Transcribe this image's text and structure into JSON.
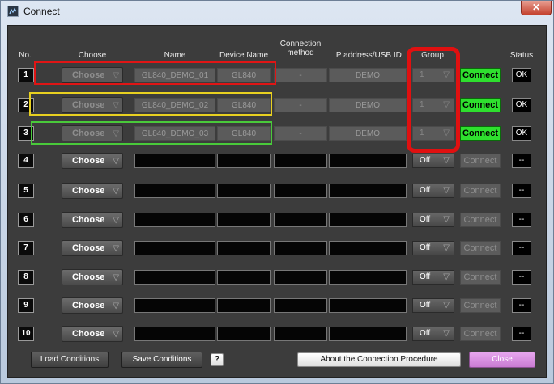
{
  "window": {
    "title": "Connect",
    "close_glyph": "✕"
  },
  "columns": {
    "no": "No.",
    "choose": "Choose",
    "name": "Name",
    "device_name": "Device Name",
    "connection_method": "Connection method",
    "ip_usb": "IP address/USB ID",
    "group": "Group",
    "status": "Status"
  },
  "rows": [
    {
      "no": "1",
      "choose": "Choose",
      "name": "GL840_DEMO_01",
      "device": "GL840",
      "method": "-",
      "ip": "DEMO",
      "group": "1",
      "connect": "Connect",
      "status": "OK",
      "active": true
    },
    {
      "no": "2",
      "choose": "Choose",
      "name": "GL840_DEMO_02",
      "device": "GL840",
      "method": "-",
      "ip": "DEMO",
      "group": "1",
      "connect": "Connect",
      "status": "OK",
      "active": true
    },
    {
      "no": "3",
      "choose": "Choose",
      "name": "GL840_DEMO_03",
      "device": "GL840",
      "method": "-",
      "ip": "DEMO",
      "group": "1",
      "connect": "Connect",
      "status": "OK",
      "active": true
    },
    {
      "no": "4",
      "choose": "Choose",
      "name": "",
      "device": "",
      "method": "",
      "ip": "",
      "group": "Off",
      "connect": "Connect",
      "status": "--",
      "active": false
    },
    {
      "no": "5",
      "choose": "Choose",
      "name": "",
      "device": "",
      "method": "",
      "ip": "",
      "group": "Off",
      "connect": "Connect",
      "status": "--",
      "active": false
    },
    {
      "no": "6",
      "choose": "Choose",
      "name": "",
      "device": "",
      "method": "",
      "ip": "",
      "group": "Off",
      "connect": "Connect",
      "status": "--",
      "active": false
    },
    {
      "no": "7",
      "choose": "Choose",
      "name": "",
      "device": "",
      "method": "",
      "ip": "",
      "group": "Off",
      "connect": "Connect",
      "status": "--",
      "active": false
    },
    {
      "no": "8",
      "choose": "Choose",
      "name": "",
      "device": "",
      "method": "",
      "ip": "",
      "group": "Off",
      "connect": "Connect",
      "status": "--",
      "active": false
    },
    {
      "no": "9",
      "choose": "Choose",
      "name": "",
      "device": "",
      "method": "",
      "ip": "",
      "group": "Off",
      "connect": "Connect",
      "status": "--",
      "active": false
    },
    {
      "no": "10",
      "choose": "Choose",
      "name": "",
      "device": "",
      "method": "",
      "ip": "",
      "group": "Off",
      "connect": "Connect",
      "status": "--",
      "active": false
    }
  ],
  "footer": {
    "load": "Load Conditions",
    "save": "Save Conditions",
    "help": "?",
    "about": "About the Connection Procedure",
    "close": "Close"
  },
  "colors": {
    "connect_active": "#2ee02e",
    "highlight_row1": "#e01515",
    "highlight_row2": "#e8d020",
    "highlight_row3": "#49c93a",
    "highlight_group": "#e01010",
    "close_button": "#d98ee2"
  }
}
